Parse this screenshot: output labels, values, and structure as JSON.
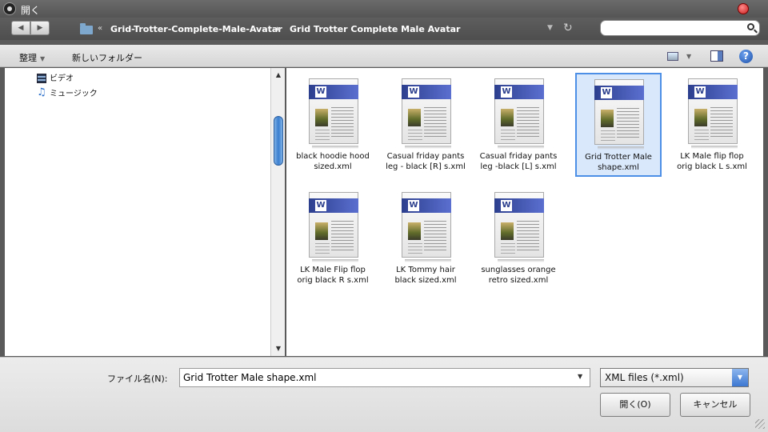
{
  "window": {
    "title": "開く"
  },
  "nav": {
    "back_glyph": "◀",
    "forward_glyph": "▶",
    "breadcrumb_overflow": "«",
    "breadcrumb": [
      "Grid-Trotter-Complete-Male-Avatar",
      "Grid Trotter Complete Male Avatar"
    ],
    "breadcrumb_separator": "▶",
    "search_placeholder": ""
  },
  "toolbar": {
    "organize_label": "整理",
    "new_folder_label": "新しいフォルダー",
    "help_glyph": "?"
  },
  "sidebar": {
    "items": [
      {
        "label": "ビデオ",
        "icon": "video-icon"
      },
      {
        "label": "ミュージック",
        "icon": "music-icon"
      }
    ]
  },
  "files": [
    {
      "name": "black hoodie hood sized.xml",
      "selected": false
    },
    {
      "name": "Casual friday pants leg - black [R] s.xml",
      "selected": false
    },
    {
      "name": "Casual friday pants leg -black [L] s.xml",
      "selected": false
    },
    {
      "name": "Grid Trotter Male shape.xml",
      "selected": true
    },
    {
      "name": "LK Male flip flop orig black L s.xml",
      "selected": false
    },
    {
      "name": "LK Male Flip flop orig black R s.xml",
      "selected": false
    },
    {
      "name": "LK Tommy hair black sized.xml",
      "selected": false
    },
    {
      "name": "sunglasses orange retro sized.xml",
      "selected": false
    }
  ],
  "doc_icon_letter": "W",
  "bottom": {
    "filename_label": "ファイル名(N):",
    "filename_value": "Grid Trotter Male shape.xml",
    "filter_value": "XML files (*.xml)",
    "open_label": "開く(O)",
    "cancel_label": "キャンセル"
  },
  "colors": {
    "selection": "#d9e8fb",
    "selection_border": "#4d8ee6",
    "accent": "#3c77d1"
  }
}
